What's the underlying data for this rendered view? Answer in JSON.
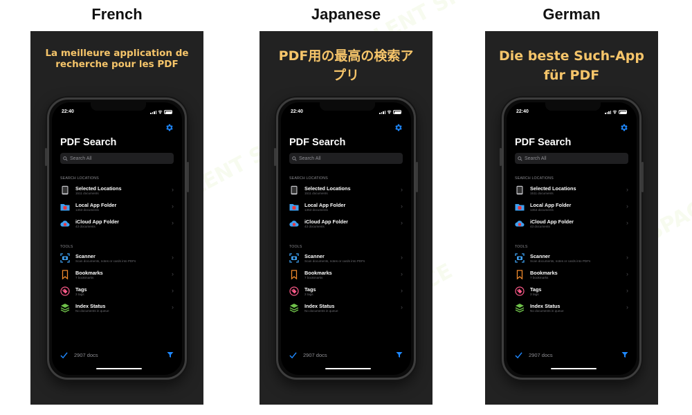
{
  "columns": [
    {
      "language": "French",
      "headline": "La meilleure application de recherche pour les PDF",
      "headline_style": "small"
    },
    {
      "language": "Japanese",
      "headline": "PDF用の最高の検索アプリ",
      "headline_style": "big"
    },
    {
      "language": "German",
      "headline": "Die beste Such-App für PDF",
      "headline_style": "big"
    }
  ],
  "app": {
    "time": "22:40",
    "title": "PDF Search",
    "search_placeholder": "Search All",
    "search_locations_header": "SEARCH LOCATIONS",
    "tools_header": "TOOLS",
    "locations": [
      {
        "title": "Selected Locations",
        "subtitle": "1511 documents",
        "icon": "tablet-icon"
      },
      {
        "title": "Local App Folder",
        "subtitle": "1353 documents",
        "icon": "folder-icon"
      },
      {
        "title": "iCloud App Folder",
        "subtitle": "43 documents",
        "icon": "cloud-icon"
      }
    ],
    "tools": [
      {
        "title": "Scanner",
        "subtitle": "Scan documents, notes or cards into PDFs",
        "icon": "scanner-icon"
      },
      {
        "title": "Bookmarks",
        "subtitle": "7 bookmarks",
        "icon": "bookmark-icon"
      },
      {
        "title": "Tags",
        "subtitle": "3 tags",
        "icon": "tag-icon"
      },
      {
        "title": "Index Status",
        "subtitle": "No documents in queue",
        "icon": "layers-icon"
      }
    ],
    "doc_count": "2907 docs"
  },
  "watermark": "AI TALENT SPACE",
  "colors": {
    "headline": "#f6c56a",
    "accent_blue": "#1e88ff",
    "panel": "#222222"
  }
}
